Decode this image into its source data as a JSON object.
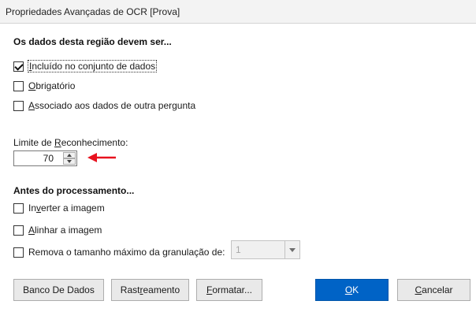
{
  "window": {
    "title": "Propriedades Avançadas de OCR [Prova]"
  },
  "section1": {
    "heading": "Os dados desta região devem ser...",
    "options": [
      {
        "pre": "",
        "u": "I",
        "post": "ncluído no conjunto de dados",
        "checked": true
      },
      {
        "pre": "",
        "u": "O",
        "post": "brigatório",
        "checked": false
      },
      {
        "pre": "",
        "u": "A",
        "post": "ssociado aos dados de outra pergunta",
        "checked": false
      }
    ]
  },
  "threshold": {
    "label_pre": "Limite de ",
    "label_u": "R",
    "label_post": "econhecimento:",
    "value": "70"
  },
  "section2": {
    "heading": "Antes do processamento...",
    "options": [
      {
        "pre": "In",
        "u": "v",
        "post": "erter a imagem",
        "checked": false
      },
      {
        "pre": "",
        "u": "A",
        "post": "linhar a imagem",
        "checked": false
      },
      {
        "pre": "Remova o tamanho máximo da granulação de:",
        "u": "",
        "post": "",
        "checked": false
      }
    ],
    "granulation_value": "1"
  },
  "buttons": {
    "database": "Banco De Dados",
    "tracking_pre": "Rast",
    "tracking_u": "r",
    "tracking_post": "eamento",
    "format_u": "F",
    "format_post": "ormatar...",
    "ok_u": "O",
    "ok_post": "K",
    "cancel_u": "C",
    "cancel_post": "ancelar"
  },
  "colors": {
    "ok_blue": "#0063c6",
    "annotation_red": "#e8121f"
  }
}
